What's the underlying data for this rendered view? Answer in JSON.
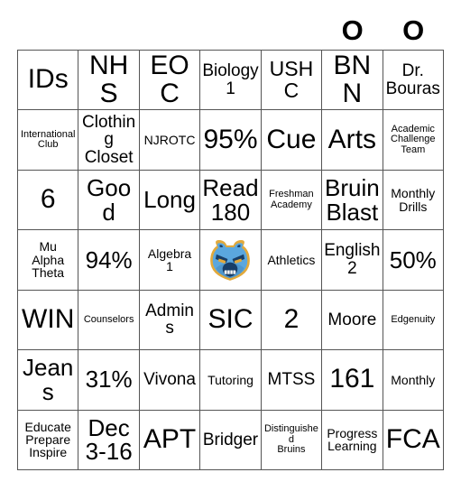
{
  "card": {
    "columns": 7,
    "rows": 7,
    "grid_line_color": "#555555",
    "background_color": "#ffffff",
    "text_color": "#000000"
  },
  "markers": {
    "letters": [
      "",
      "",
      "",
      "",
      "",
      "O",
      "O"
    ]
  },
  "logo": {
    "name": "bruin-bear-head-logo",
    "colors": {
      "face": "#5BA7DE",
      "face_shadow": "#3E84BB",
      "outline": "#E2A93B",
      "detail": "#173E68",
      "teeth": "#FFFFFF"
    }
  },
  "cells": [
    [
      {
        "text": "IDs",
        "size": "xxl"
      },
      {
        "text": "NHS",
        "size": "xxl"
      },
      {
        "text": "EOC",
        "size": "xxl"
      },
      {
        "text": "Biology\n1",
        "size": "md"
      },
      {
        "text": "USHC",
        "size": "lg"
      },
      {
        "text": "BNN",
        "size": "xxl"
      },
      {
        "text": "Dr.\nBouras",
        "size": "md"
      }
    ],
    [
      {
        "text": "International\nClub",
        "size": "xs"
      },
      {
        "text": "Clothing\nCloset",
        "size": "md"
      },
      {
        "text": "NJROTC",
        "size": "sm"
      },
      {
        "text": "95%",
        "size": "xxl"
      },
      {
        "text": "Cue",
        "size": "xxl"
      },
      {
        "text": "Arts",
        "size": "xxl"
      },
      {
        "text": "Academic\nChallenge\nTeam",
        "size": "xs"
      }
    ],
    [
      {
        "text": "6",
        "size": "xxl"
      },
      {
        "text": "Good",
        "size": "xl"
      },
      {
        "text": "Long",
        "size": "xl"
      },
      {
        "text": "Read\n180",
        "size": "xl"
      },
      {
        "text": "Freshman\nAcademy",
        "size": "xs"
      },
      {
        "text": "Bruin\nBlast",
        "size": "xl"
      },
      {
        "text": "Monthly\nDrills",
        "size": "sm"
      }
    ],
    [
      {
        "text": "Mu\nAlpha\nTheta",
        "size": "sm"
      },
      {
        "text": "94%",
        "size": "xl"
      },
      {
        "text": "Algebra\n1",
        "size": "sm"
      },
      {
        "text": "",
        "size": "md",
        "logo": true
      },
      {
        "text": "Athletics",
        "size": "sm"
      },
      {
        "text": "English\n2",
        "size": "md"
      },
      {
        "text": "50%",
        "size": "xl"
      }
    ],
    [
      {
        "text": "WIN",
        "size": "xxl"
      },
      {
        "text": "Counselors",
        "size": "xs"
      },
      {
        "text": "Admins",
        "size": "md"
      },
      {
        "text": "SIC",
        "size": "xxl"
      },
      {
        "text": "2",
        "size": "xxl"
      },
      {
        "text": "Moore",
        "size": "md"
      },
      {
        "text": "Edgenuity",
        "size": "xs"
      }
    ],
    [
      {
        "text": "Jeans",
        "size": "xl"
      },
      {
        "text": "31%",
        "size": "xl"
      },
      {
        "text": "Vivona",
        "size": "md"
      },
      {
        "text": "Tutoring",
        "size": "sm"
      },
      {
        "text": "MTSS",
        "size": "md"
      },
      {
        "text": "161",
        "size": "xxl"
      },
      {
        "text": "Monthly",
        "size": "sm"
      }
    ],
    [
      {
        "text": "Educate\nPrepare\nInspire",
        "size": "sm"
      },
      {
        "text": "Dec\n3-16",
        "size": "xl"
      },
      {
        "text": "APT",
        "size": "xxl"
      },
      {
        "text": "Bridger",
        "size": "md"
      },
      {
        "text": "Distinguished\nBruins",
        "size": "xs"
      },
      {
        "text": "Progress\nLearning",
        "size": "sm"
      },
      {
        "text": "FCA",
        "size": "xxl"
      }
    ]
  ]
}
